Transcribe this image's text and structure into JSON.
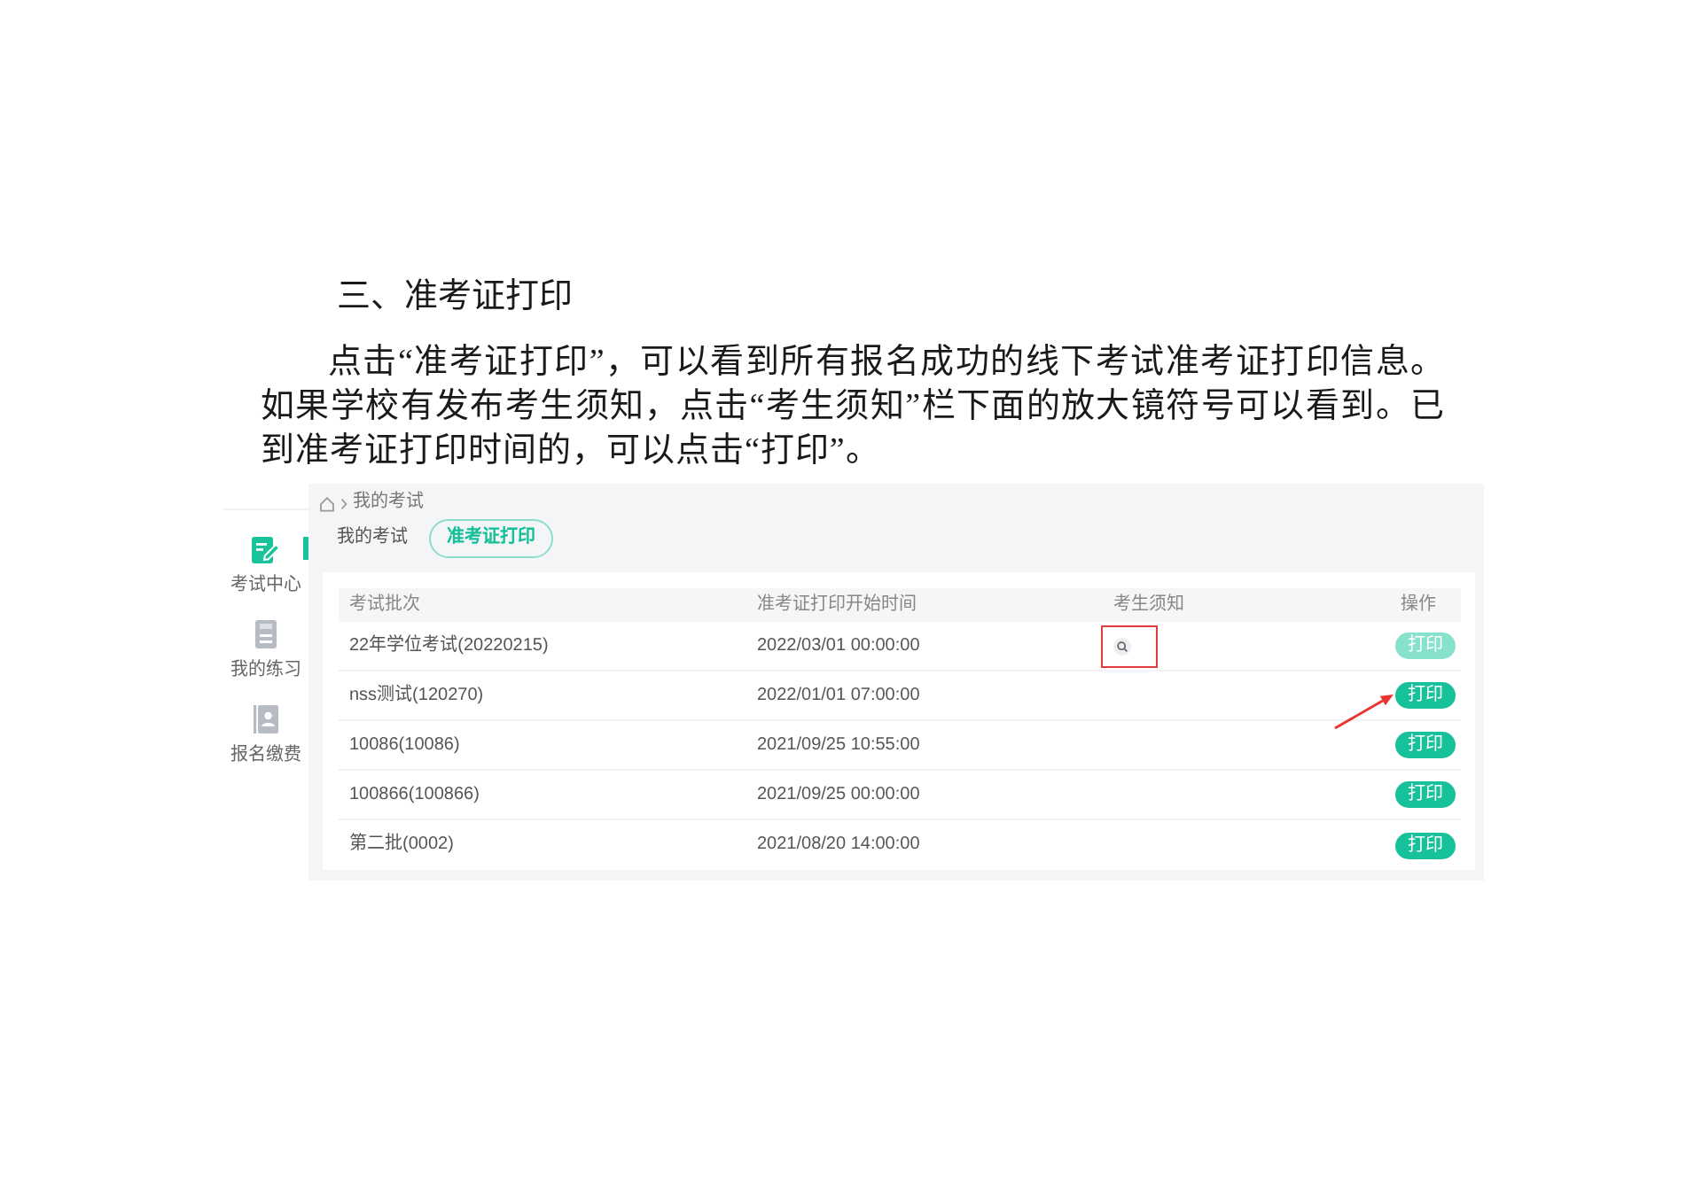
{
  "document": {
    "heading": "三、准考证打印",
    "paragraph": "点击“准考证打印”，可以看到所有报名成功的线下考试准考证打印信息。如果学校有发布考生须知，点击“考生须知”栏下面的放大镜符号可以看到。已到准考证打印时间的，可以点击“打印”。"
  },
  "screenshot": {
    "sidebar": {
      "items": [
        {
          "label": "考试中心",
          "selected": true
        },
        {
          "label": "我的练习",
          "selected": false
        },
        {
          "label": "报名缴费",
          "selected": false
        }
      ]
    },
    "breadcrumb": [
      "我的考试"
    ],
    "tabs": [
      {
        "label": "我的考试",
        "selected": false
      },
      {
        "label": "准考证打印",
        "selected": true
      }
    ],
    "table": {
      "columns": [
        "考试批次",
        "准考证打印开始时间",
        "考生须知",
        "操作"
      ],
      "rows": [
        {
          "batch": "22年学位考试(20220215)",
          "print_start_time": "2022/03/01 00:00:00",
          "notice": true,
          "notice_annotated": true,
          "action": {
            "label": "打印",
            "disabled": true,
            "annotated": false
          }
        },
        {
          "batch": "nss测试(120270)",
          "print_start_time": "2022/01/01 07:00:00",
          "notice": false,
          "notice_annotated": false,
          "action": {
            "label": "打印",
            "disabled": false,
            "annotated": true
          }
        },
        {
          "batch": "10086(10086)",
          "print_start_time": "2021/09/25 10:55:00",
          "notice": false,
          "notice_annotated": false,
          "action": {
            "label": "打印",
            "disabled": false,
            "annotated": false
          }
        },
        {
          "batch": "100866(100866)",
          "print_start_time": "2021/09/25 00:00:00",
          "notice": false,
          "notice_annotated": false,
          "action": {
            "label": "打印",
            "disabled": false,
            "annotated": false
          }
        },
        {
          "batch": "第二批(0002)",
          "print_start_time": "2021/08/20 14:00:00",
          "notice": false,
          "notice_annotated": false,
          "action": {
            "label": "打印",
            "disabled": false,
            "annotated": false
          }
        }
      ]
    }
  }
}
